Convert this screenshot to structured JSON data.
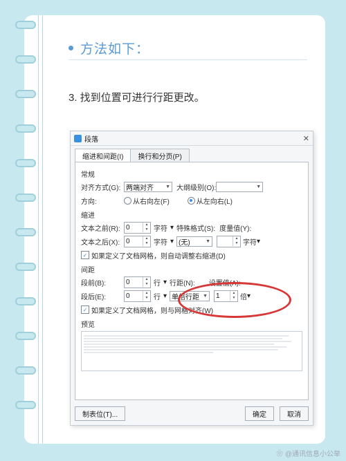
{
  "page": {
    "title": "方法如下：",
    "step": "3. 找到位置可进行行距更改。",
    "watermark": "❀ @通讯信息小公举"
  },
  "dialog": {
    "title": "段落",
    "tabs": {
      "indent": "缩进和间距(I)",
      "line": "换行和分页(P)"
    },
    "general": "常规",
    "alignment_label": "对齐方式(G):",
    "alignment_value": "两端对齐",
    "outline_label": "大纲级别(O):",
    "outline_value": "",
    "direction_label": "方向:",
    "dir_rtl": "从右向左(F)",
    "dir_ltr": "从左向右(L)",
    "indent": "缩进",
    "before_text": "文本之前(R):",
    "after_text": "文本之后(X):",
    "zero": "0",
    "char_unit": "字符",
    "special_label": "特殊格式(S):",
    "special_value": "(无)",
    "by_label": "度量值(Y):",
    "auto_indent": "如果定义了文档网格，则自动调整右缩进(D)",
    "spacing": "间距",
    "before_para": "段前(B):",
    "after_para": "段后(E):",
    "line_unit": "行",
    "line_spacing_label": "行距(N):",
    "line_spacing_value": "单倍行距",
    "at_label": "设置值(A):",
    "at_value": "1",
    "bei": "倍",
    "snap_grid": "如果定义了文档网格，则与网格对齐(W)",
    "preview": "预览",
    "tabs_btn": "制表位(T)...",
    "ok": "确定",
    "cancel": "取消"
  }
}
